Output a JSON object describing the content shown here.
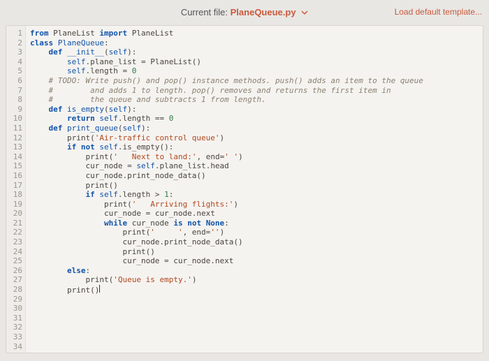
{
  "header": {
    "prefix": "Current file:",
    "filename": "PlaneQueue.py",
    "load_template": "Load default template..."
  },
  "editor": {
    "line_count": 34,
    "code": [
      {
        "indent": 0,
        "fragments": [
          {
            "t": "from ",
            "cls": "k"
          },
          {
            "t": "PlaneList "
          },
          {
            "t": "import ",
            "cls": "k"
          },
          {
            "t": "PlaneList"
          }
        ]
      },
      {
        "indent": 0,
        "fragments": []
      },
      {
        "indent": 0,
        "fragments": [
          {
            "t": "class ",
            "cls": "k"
          },
          {
            "t": "PlaneQueue",
            "cls": "fn"
          },
          {
            "t": ":"
          }
        ]
      },
      {
        "indent": 1,
        "fragments": [
          {
            "t": "def ",
            "cls": "k"
          },
          {
            "t": "__init__",
            "cls": "fn"
          },
          {
            "t": "("
          },
          {
            "t": "self",
            "cls": "sel"
          },
          {
            "t": "):"
          }
        ]
      },
      {
        "indent": 2,
        "fragments": [
          {
            "t": "self",
            "cls": "sel"
          },
          {
            "t": ".plane_list = PlaneList()"
          }
        ]
      },
      {
        "indent": 2,
        "fragments": [
          {
            "t": "self",
            "cls": "sel"
          },
          {
            "t": ".length = "
          },
          {
            "t": "0",
            "cls": "n"
          }
        ]
      },
      {
        "indent": 0,
        "fragments": []
      },
      {
        "indent": 1,
        "fragments": [
          {
            "t": "# TODO: Write push() and pop() instance methods. push() adds an item to the queue",
            "cls": "c"
          }
        ]
      },
      {
        "indent": 1,
        "fragments": [
          {
            "t": "#        and adds 1 to length. pop() removes and returns the first item in",
            "cls": "c"
          }
        ]
      },
      {
        "indent": 1,
        "fragments": [
          {
            "t": "#        the queue and subtracts 1 from length.",
            "cls": "c"
          }
        ]
      },
      {
        "indent": 0,
        "fragments": []
      },
      {
        "indent": 0,
        "fragments": []
      },
      {
        "indent": 1,
        "fragments": [
          {
            "t": "def ",
            "cls": "k"
          },
          {
            "t": "is_empty",
            "cls": "fn"
          },
          {
            "t": "("
          },
          {
            "t": "self",
            "cls": "sel"
          },
          {
            "t": "):"
          }
        ]
      },
      {
        "indent": 2,
        "fragments": [
          {
            "t": "return ",
            "cls": "k"
          },
          {
            "t": "self",
            "cls": "sel"
          },
          {
            "t": ".length == "
          },
          {
            "t": "0",
            "cls": "n"
          }
        ]
      },
      {
        "indent": 0,
        "fragments": []
      },
      {
        "indent": 1,
        "fragments": [
          {
            "t": "def ",
            "cls": "k"
          },
          {
            "t": "print_queue",
            "cls": "fn"
          },
          {
            "t": "("
          },
          {
            "t": "self",
            "cls": "sel"
          },
          {
            "t": "):"
          }
        ]
      },
      {
        "indent": 2,
        "fragments": [
          {
            "t": "print("
          },
          {
            "t": "'Air-traffic control queue'",
            "cls": "s"
          },
          {
            "t": ")"
          }
        ]
      },
      {
        "indent": 2,
        "fragments": [
          {
            "t": "if ",
            "cls": "k"
          },
          {
            "t": "not ",
            "cls": "k"
          },
          {
            "t": "self",
            "cls": "sel"
          },
          {
            "t": ".is_empty():"
          }
        ]
      },
      {
        "indent": 3,
        "fragments": [
          {
            "t": "print("
          },
          {
            "t": "'   Next to land:'",
            "cls": "s"
          },
          {
            "t": ", end="
          },
          {
            "t": "' '",
            "cls": "s"
          },
          {
            "t": ")"
          }
        ]
      },
      {
        "indent": 3,
        "fragments": [
          {
            "t": "cur_node = "
          },
          {
            "t": "self",
            "cls": "sel"
          },
          {
            "t": ".plane_list.head"
          }
        ]
      },
      {
        "indent": 3,
        "fragments": [
          {
            "t": "cur_node.print_node_data()"
          }
        ]
      },
      {
        "indent": 3,
        "fragments": [
          {
            "t": "print()"
          }
        ]
      },
      {
        "indent": 0,
        "fragments": []
      },
      {
        "indent": 3,
        "fragments": [
          {
            "t": "if ",
            "cls": "k"
          },
          {
            "t": "self",
            "cls": "sel"
          },
          {
            "t": ".length > "
          },
          {
            "t": "1",
            "cls": "n"
          },
          {
            "t": ":"
          }
        ]
      },
      {
        "indent": 4,
        "fragments": [
          {
            "t": "print("
          },
          {
            "t": "'   Arriving flights:'",
            "cls": "s"
          },
          {
            "t": ")"
          }
        ]
      },
      {
        "indent": 4,
        "fragments": [
          {
            "t": "cur_node = cur_node.next"
          }
        ]
      },
      {
        "indent": 4,
        "fragments": [
          {
            "t": "while ",
            "cls": "k"
          },
          {
            "t": "cur_node "
          },
          {
            "t": "is not ",
            "cls": "k"
          },
          {
            "t": "None",
            "cls": "k"
          },
          {
            "t": ":"
          }
        ]
      },
      {
        "indent": 5,
        "fragments": [
          {
            "t": "print("
          },
          {
            "t": "'     '",
            "cls": "s"
          },
          {
            "t": ", end="
          },
          {
            "t": "''",
            "cls": "s"
          },
          {
            "t": ")"
          }
        ]
      },
      {
        "indent": 5,
        "fragments": [
          {
            "t": "cur_node.print_node_data()"
          }
        ]
      },
      {
        "indent": 5,
        "fragments": [
          {
            "t": "print()"
          }
        ]
      },
      {
        "indent": 5,
        "fragments": [
          {
            "t": "cur_node = cur_node.next"
          }
        ]
      },
      {
        "indent": 2,
        "fragments": [
          {
            "t": "else",
            "cls": "k"
          },
          {
            "t": ":"
          }
        ]
      },
      {
        "indent": 3,
        "fragments": [
          {
            "t": "print("
          },
          {
            "t": "'Queue is empty.'",
            "cls": "s"
          },
          {
            "t": ")"
          }
        ]
      },
      {
        "indent": 2,
        "fragments": [
          {
            "t": "print()"
          }
        ]
      }
    ]
  }
}
